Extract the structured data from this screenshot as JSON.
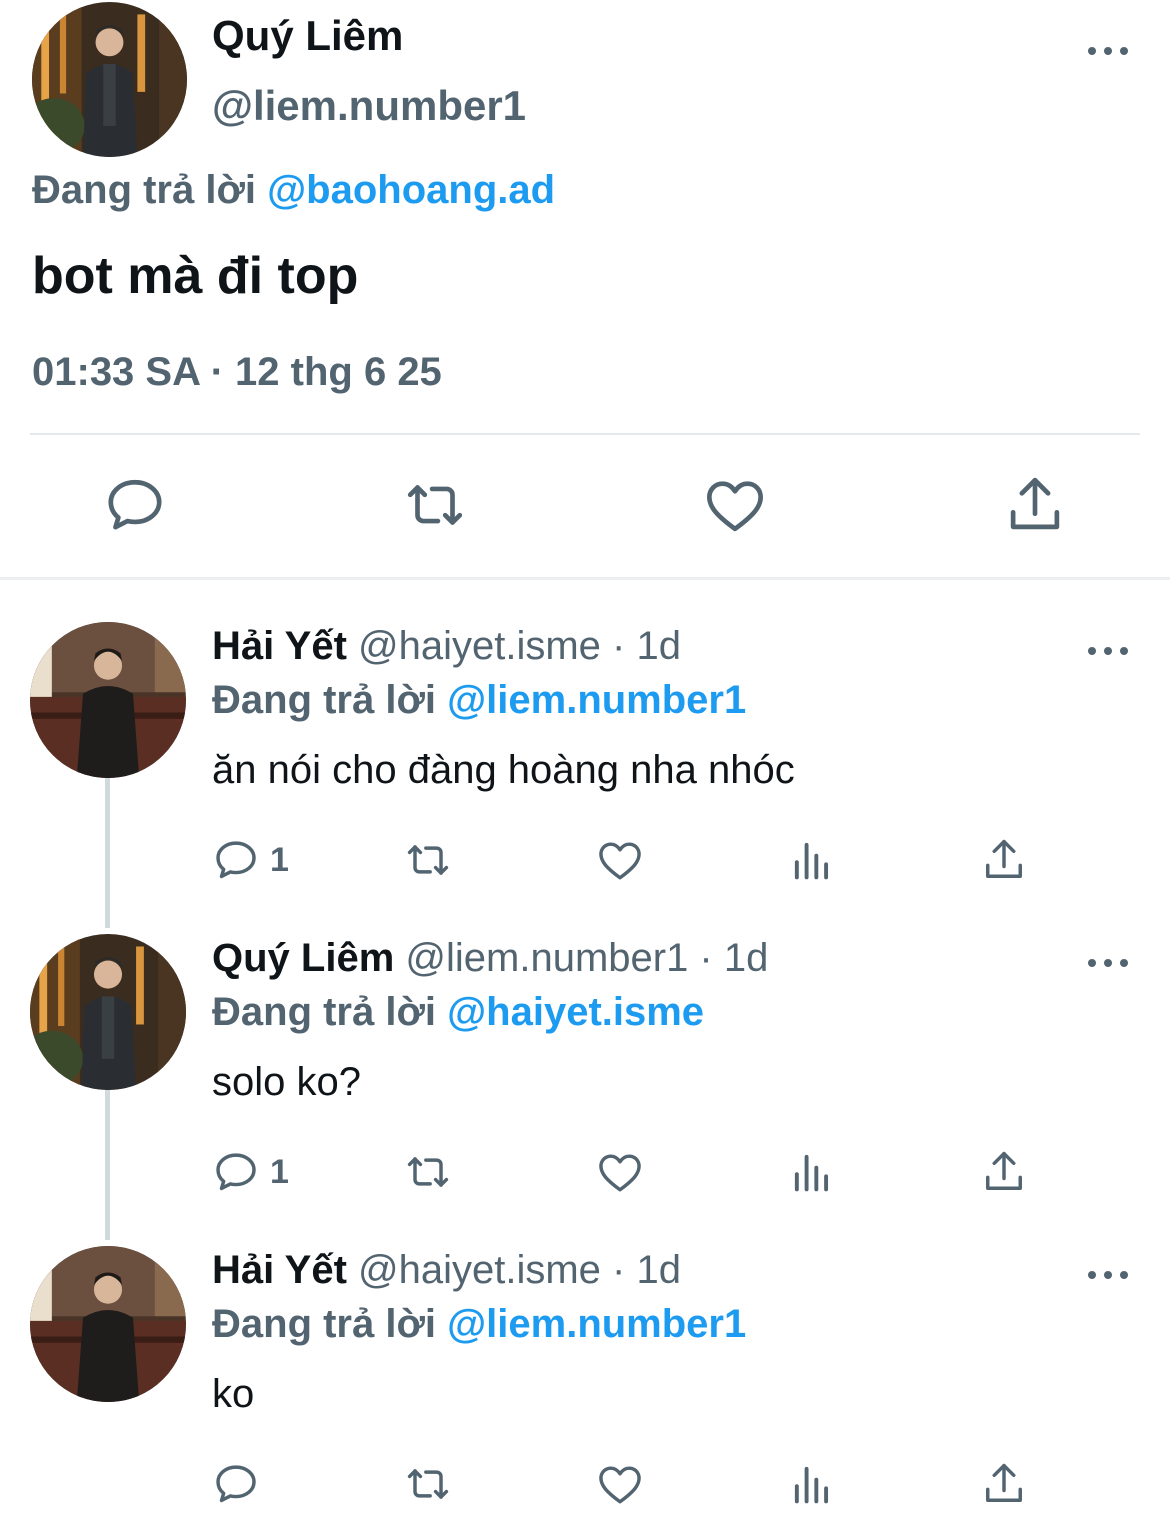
{
  "colors": {
    "text": "#0f1419",
    "secondary": "#536471",
    "accent": "#1d9bf0",
    "divider": "#e6e9eb"
  },
  "main_tweet": {
    "author_name": "Quý Liêm",
    "author_handle": "@liem.number1",
    "replying_label": "Đang trả lời",
    "replying_to": "@baohoang.ad",
    "text": "bot mà đi top",
    "timestamp": "01:33 SA · 12 thg 6 25",
    "actions": [
      "reply-icon",
      "retweet-icon",
      "like-icon",
      "share-icon"
    ]
  },
  "replies": [
    {
      "author_name": "Hải Yết",
      "meta": "@haiyet.isme · 1d",
      "replying_label": "Đang trả lời",
      "replying_to": "@liem.number1",
      "text": "ăn nói cho đàng hoàng nha nhóc",
      "reply_count": "1"
    },
    {
      "author_name": "Quý Liêm",
      "meta": "@liem.number1 · 1d",
      "replying_label": "Đang trả lời",
      "replying_to": "@haiyet.isme",
      "text": "solo ko?",
      "reply_count": "1"
    },
    {
      "author_name": "Hải Yết",
      "meta": "@haiyet.isme · 1d",
      "replying_label": "Đang trả lời",
      "replying_to": "@liem.number1",
      "text": "ko",
      "reply_count": ""
    }
  ]
}
